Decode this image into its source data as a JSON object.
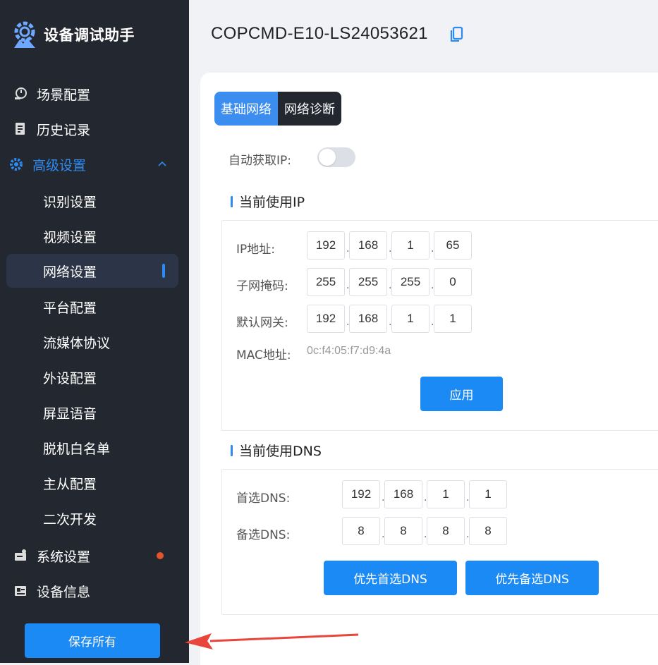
{
  "app": {
    "title": "设备调试助手"
  },
  "colors": {
    "accent": "#1b8af5",
    "sidebar_bg": "#23272f",
    "notice_dot": "#e5532d",
    "annotation_arrow": "#e8453c"
  },
  "sidebar": {
    "items": [
      {
        "label": "场景配置",
        "icon": "scene-icon"
      },
      {
        "label": "历史记录",
        "icon": "history-icon"
      },
      {
        "label": "高级设置",
        "icon": "advanced-gear-icon",
        "expanded": true
      },
      {
        "label": "系统设置",
        "icon": "system-icon",
        "has_notice": true
      },
      {
        "label": "设备信息",
        "icon": "device-info-icon"
      }
    ],
    "sub_items": [
      "识别设置",
      "视频设置",
      "网络设置",
      "平台配置",
      "流媒体协议",
      "外设配置",
      "屏显语音",
      "脱机白名单",
      "主从配置",
      "二次开发"
    ],
    "selected_sub_item": "网络设置",
    "save_all_label": "保存所有"
  },
  "header": {
    "device_id": "COPCMD-E10-LS24053621"
  },
  "tabs": [
    {
      "label": "基础网络",
      "active": true
    },
    {
      "label": "网络诊断",
      "active": false
    }
  ],
  "auto_ip": {
    "label": "自动获取IP:",
    "enabled": false
  },
  "ip_section": {
    "title": "当前使用IP",
    "ip_label": "IP地址:",
    "ip": [
      "192",
      "168",
      "1",
      "65"
    ],
    "mask_label": "子网掩码:",
    "mask": [
      "255",
      "255",
      "255",
      "0"
    ],
    "gateway_label": "默认网关:",
    "gateway": [
      "192",
      "168",
      "1",
      "1"
    ],
    "mac_label": "MAC地址:",
    "mac": "0c:f4:05:f7:d9:4a",
    "apply_label": "应用"
  },
  "dns_section": {
    "title": "当前使用DNS",
    "primary_label": "首选DNS:",
    "primary": [
      "192",
      "168",
      "1",
      "1"
    ],
    "secondary_label": "备选DNS:",
    "secondary": [
      "8",
      "8",
      "8",
      "8"
    ],
    "prefer_primary_label": "优先首选DNS",
    "prefer_secondary_label": "优先备选DNS"
  }
}
